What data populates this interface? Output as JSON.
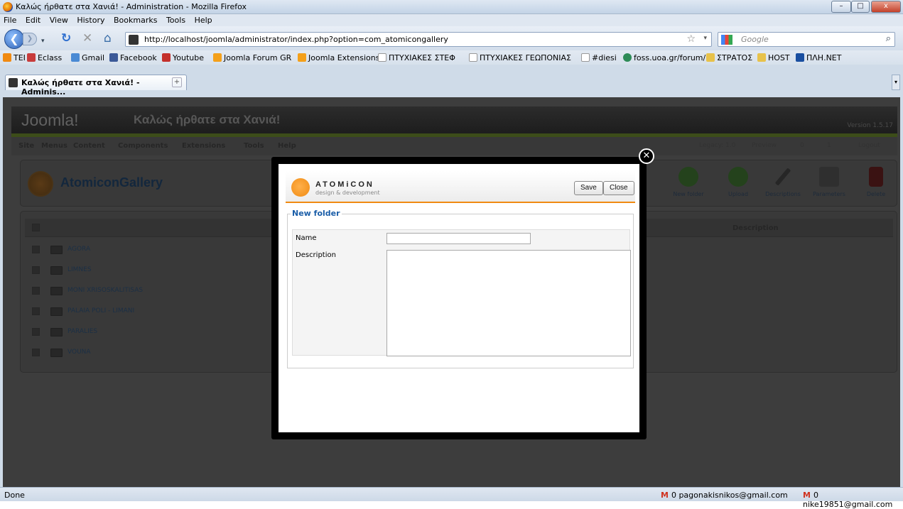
{
  "window": {
    "title": "Καλώς ήρθατε στα Χανιά! - Administration - Mozilla Firefox",
    "minimize": "–",
    "maximize": "□",
    "close": "x"
  },
  "menu": [
    "File",
    "Edit",
    "View",
    "History",
    "Bookmarks",
    "Tools",
    "Help"
  ],
  "nav": {
    "url": "http://localhost/joomla/administrator/index.php?option=com_atomicongallery",
    "search_placeholder": "Google"
  },
  "bookmarks": [
    {
      "label": "TEI",
      "color": "#f08a12"
    },
    {
      "label": "Eclass",
      "color": "#c83c3c"
    },
    {
      "label": "Gmail",
      "color": "#4a8ad4"
    },
    {
      "label": "Facebook",
      "color": "#3b5998"
    },
    {
      "label": "Youtube",
      "color": "#c4302b"
    },
    {
      "label": "Joomla Forum GR",
      "color": "#f4a01a"
    },
    {
      "label": "Joomla Extensions",
      "color": "#f4a01a"
    },
    {
      "label": "ΠΤΥΧΙΑΚΕΣ ΣΤΕΦ",
      "color": "#ffffff"
    },
    {
      "label": "ΠΤΥΧΙΑΚΕΣ ΓΕΩΠΟΝΙΑΣ",
      "color": "#ffffff"
    },
    {
      "label": "#diesi",
      "color": "#ffffff"
    },
    {
      "label": "foss.uoa.gr/forum/",
      "color": "#2e8b57"
    },
    {
      "label": "ΣΤΡΑΤΟΣ",
      "color": "#e8c24a"
    },
    {
      "label": "HOST",
      "color": "#e8c24a"
    },
    {
      "label": "ΠΛΗ.ΝΕΤ",
      "color": "#1a4fa0"
    }
  ],
  "tab": {
    "title": "Καλώς ήρθατε στα Χανιά! - Adminis...",
    "add": "+"
  },
  "joomla": {
    "logo": "Joomla!",
    "site_name": "Καλώς ήρθατε στα Χανιά!",
    "version": "Version 1.5.17",
    "menu": [
      "Site",
      "Menus",
      "Content",
      "Components",
      "Extensions",
      "Tools",
      "Help"
    ],
    "status": {
      "legacy": "Legacy: 1.0",
      "preview": "Preview",
      "messages": "0",
      "users": "1",
      "logout": "Logout"
    },
    "component_title": "AtomiconGallery",
    "toolbar": [
      "New folder",
      "Upload",
      "Descriptions",
      "Parameters",
      "Delete"
    ],
    "list_header": {
      "description": "Description"
    },
    "folders": [
      "AGORA",
      "LIMNES",
      "MONI XRISOSKALITISAS",
      "PALAIA POLI - LIMANI",
      "PARALIES",
      "VOUNA"
    ]
  },
  "modal": {
    "brand": "ATOMiCON",
    "brand_sub": "design & development",
    "save": "Save",
    "close": "Close",
    "legend": "New folder",
    "name_label": "Name",
    "description_label": "Description",
    "name_value": "",
    "description_value": ""
  },
  "status_bar": {
    "state": "Done",
    "mail1": "0 pagonakisnikos@gmail.com",
    "mail2": "0 nike19851@gmail.com"
  }
}
